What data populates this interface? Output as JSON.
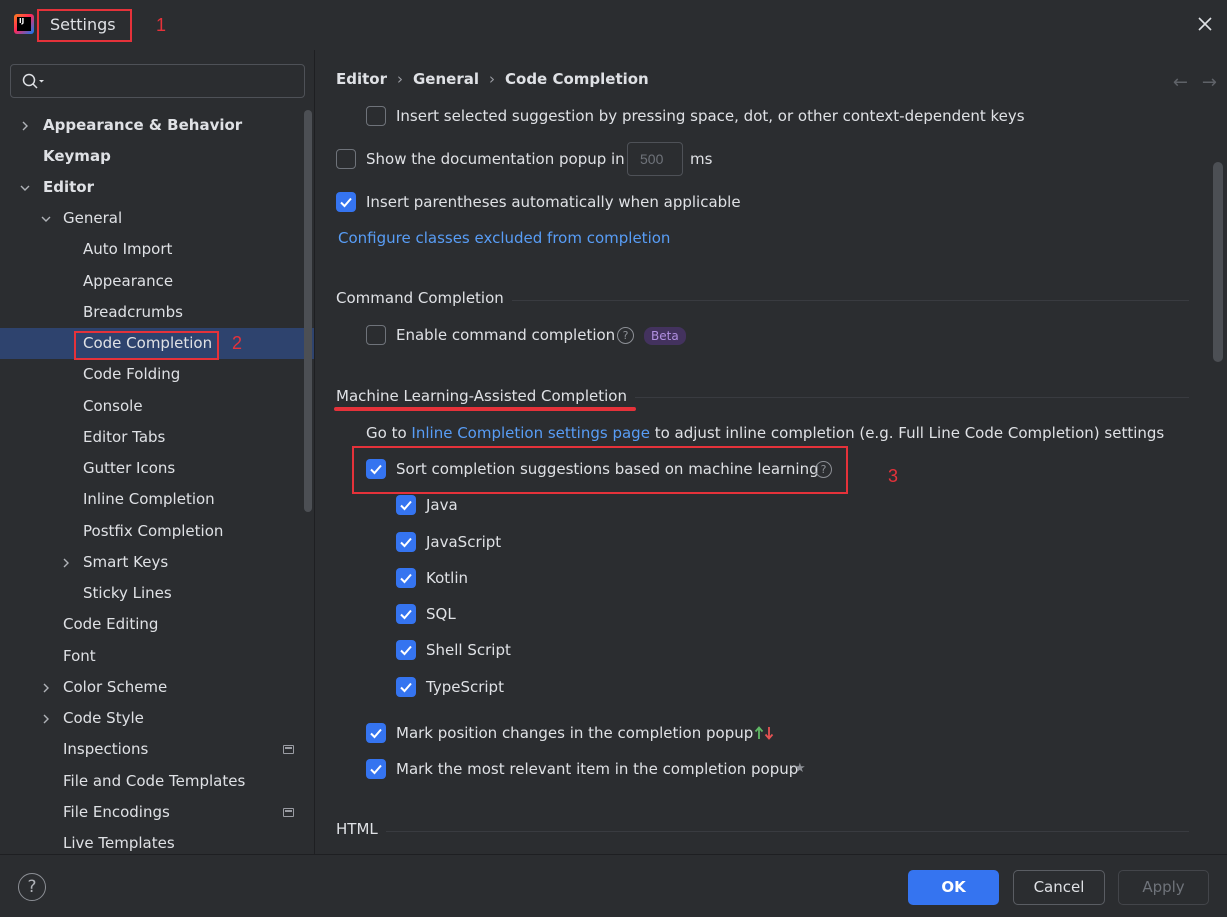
{
  "window": {
    "title": "Settings"
  },
  "annotations": {
    "n1": "1",
    "n2": "2",
    "n3": "3"
  },
  "search": {
    "placeholder": "",
    "value": ""
  },
  "tree": {
    "appearance_behavior": "Appearance & Behavior",
    "keymap": "Keymap",
    "editor": "Editor",
    "general": "General",
    "auto_import": "Auto Import",
    "appearance": "Appearance",
    "breadcrumbs": "Breadcrumbs",
    "code_completion": "Code Completion",
    "code_folding": "Code Folding",
    "console": "Console",
    "editor_tabs": "Editor Tabs",
    "gutter_icons": "Gutter Icons",
    "inline_completion": "Inline Completion",
    "postfix_completion": "Postfix Completion",
    "smart_keys": "Smart Keys",
    "sticky_lines": "Sticky Lines",
    "code_editing": "Code Editing",
    "font": "Font",
    "color_scheme": "Color Scheme",
    "code_style": "Code Style",
    "inspections": "Inspections",
    "file_code_templates": "File and Code Templates",
    "file_encodings": "File Encodings",
    "live_templates": "Live Templates"
  },
  "breadcrumb": {
    "part1": "Editor",
    "part2": "General",
    "part3": "Code Completion",
    "separator": "›"
  },
  "nav": {
    "back": "←",
    "forward": "→"
  },
  "options": {
    "insert_selected": "Insert selected suggestion by pressing space, dot, or other context-dependent keys",
    "show_doc_popup": "Show the documentation popup in",
    "doc_popup_value": "500",
    "doc_popup_unit": "ms",
    "insert_parens": "Insert parentheses automatically when applicable",
    "configure_link": "Configure classes excluded from completion"
  },
  "command_completion": {
    "title": "Command Completion",
    "enable": "Enable command completion",
    "help": "?",
    "beta": "Beta"
  },
  "ml": {
    "title": "Machine Learning-Assisted Completion",
    "goto_prefix": "Go to",
    "goto_link": "Inline Completion settings page",
    "goto_suffix": "to adjust inline completion (e.g. Full Line Code Completion) settings",
    "sort": "Sort completion suggestions based on machine learning",
    "help": "?",
    "languages": [
      "Java",
      "JavaScript",
      "Kotlin",
      "SQL",
      "Shell Script",
      "TypeScript"
    ],
    "mark_position": "Mark position changes in the completion popup",
    "mark_relevant": "Mark the most relevant item in the completion popup",
    "star": "★"
  },
  "html_section": {
    "title": "HTML"
  },
  "buttons": {
    "help": "?",
    "ok": "OK",
    "cancel": "Cancel",
    "apply": "Apply"
  },
  "colors": {
    "accent": "#3574f0",
    "selection": "#2e436e",
    "link": "#589df6",
    "annotation": "#e5323a",
    "background": "#2b2d30"
  }
}
